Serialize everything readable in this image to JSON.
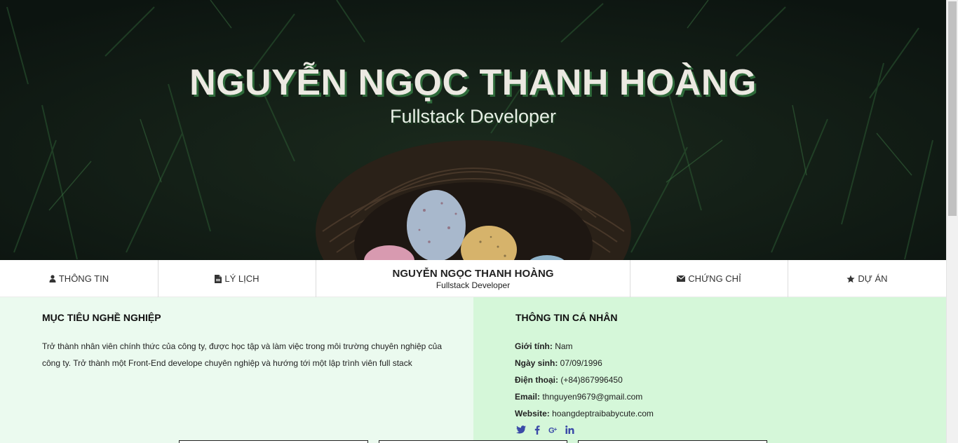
{
  "hero": {
    "name": "NGUYỄN NGỌC THANH HOÀNG",
    "role": "Fullstack Developer"
  },
  "nav": {
    "items": [
      {
        "label": "THÔNG TIN",
        "icon": "user-icon"
      },
      {
        "label": "LÝ LỊCH",
        "icon": "file-icon"
      },
      {
        "label": "CHỨNG CHỈ",
        "icon": "envelope-icon"
      },
      {
        "label": "DỰ ÁN",
        "icon": "star-icon"
      }
    ],
    "brand": {
      "name": "NGUYỄN NGỌC THANH HOÀNG",
      "role": "Fullstack Developer"
    }
  },
  "objective": {
    "title": "MỤC TIÊU NGHỀ NGHIỆP",
    "text": "Trở thành nhân viên chính thức của công ty, được học tập và làm việc trong môi trường chuyên nghiệp của công ty. Trở thành một Front-End develope chuyên nghiệp và hướng tới một lập trình viên full stack"
  },
  "personal": {
    "title": "THÔNG TIN CÁ NHÂN",
    "rows": [
      {
        "label": "Giới tính:",
        "value": " Nam"
      },
      {
        "label": "Ngày sinh:",
        "value": " 07/09/1996"
      },
      {
        "label": "Điện thoại:",
        "value": " (+84)867996450"
      },
      {
        "label": "Email:",
        "value": " thnguyen9679@gmail.com"
      },
      {
        "label": "Website:",
        "value": " hoangdeptraibabycute.com"
      }
    ],
    "socials": [
      "twitter-icon",
      "facebook-icon",
      "google-plus-icon",
      "linkedin-icon"
    ]
  },
  "colors": {
    "left_bg": "#ebfaef",
    "right_bg": "#d5f7d9",
    "social_icon": "#3b4ba8",
    "title_shadow": "#2e6a3a"
  }
}
